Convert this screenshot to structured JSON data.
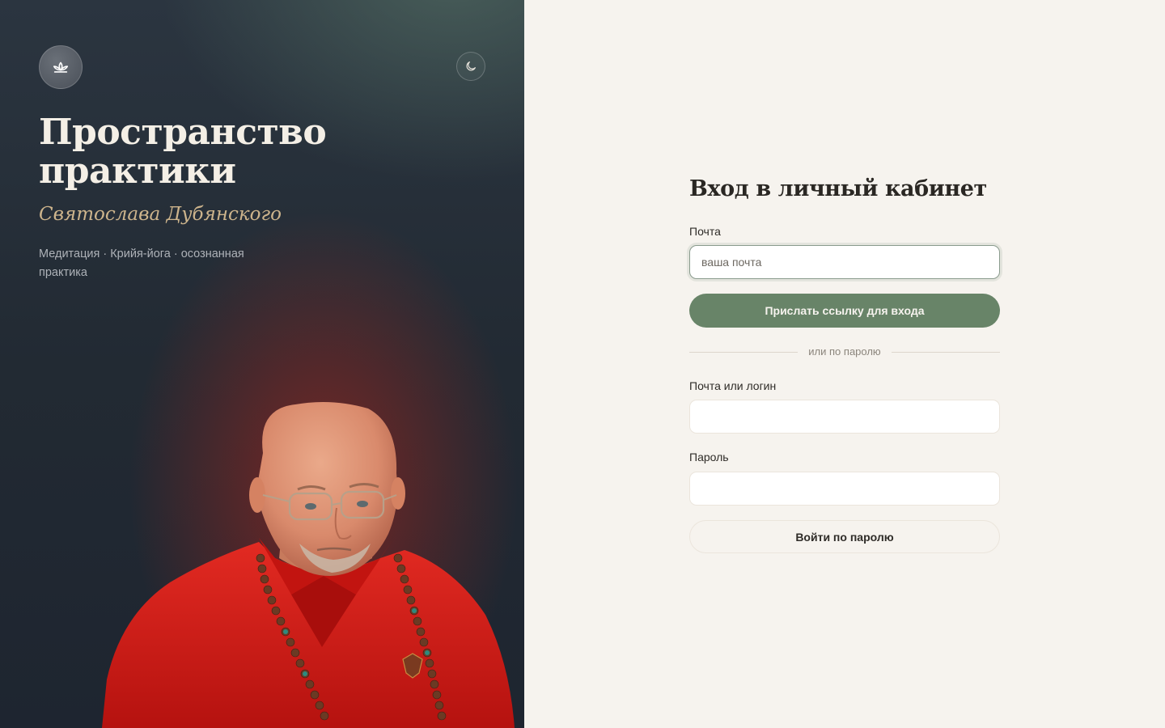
{
  "hero": {
    "title_line1": "Пространство",
    "title_line2": "практики",
    "subtitle": "Святослава Дубянского",
    "description": "Медитация · Крийя-йога · осознанная практика",
    "logo_icon": "lotus-icon",
    "theme_toggle_icon": "moon-icon"
  },
  "login": {
    "title": "Вход в личный кабинет",
    "email_label": "Почта",
    "email_placeholder": "ваша почта",
    "email_value": "",
    "magic_link_button": "Прислать ссылку для входа",
    "divider_text": "или по паролю",
    "login_label": "Почта или логин",
    "login_value": "",
    "password_label": "Пароль",
    "password_value": "",
    "password_button": "Войти по паролю"
  },
  "colors": {
    "accent_green": "#688468",
    "page_background": "#f6f3ee",
    "hero_background": "#222a33",
    "subtitle_gold": "#cdb48c"
  }
}
